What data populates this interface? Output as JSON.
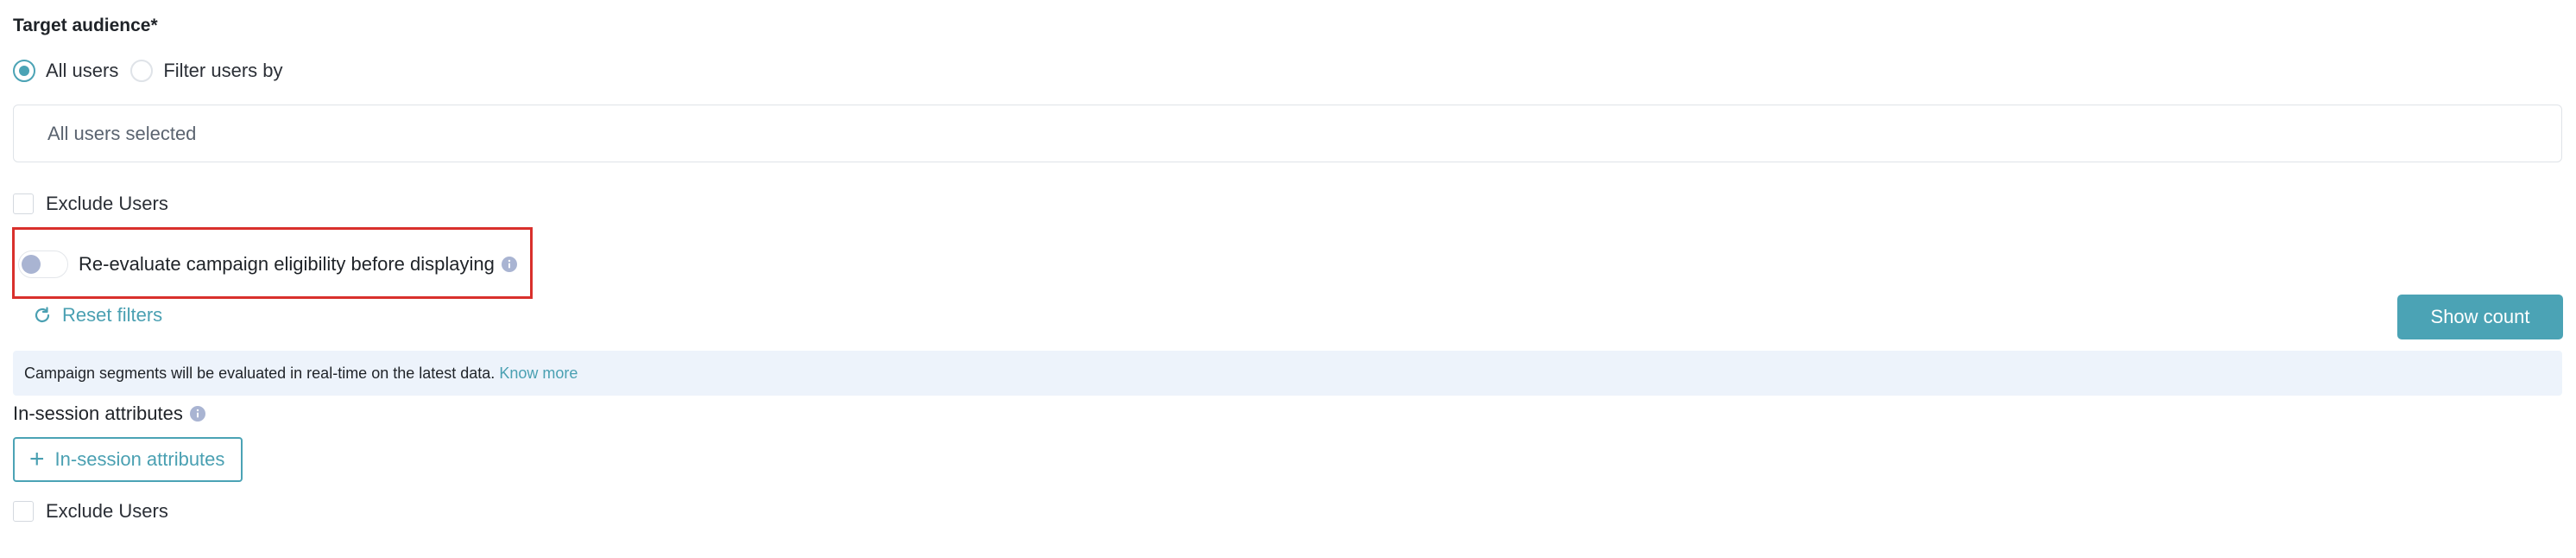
{
  "target_audience": {
    "title": "Target audience*",
    "options": [
      {
        "label": "All users",
        "selected": true
      },
      {
        "label": "Filter users by",
        "selected": false
      }
    ],
    "selection_summary": "All users selected",
    "exclude_users_label": "Exclude Users"
  },
  "reevaluate": {
    "label": "Re-evaluate campaign eligibility before displaying",
    "enabled": false,
    "info_icon": "info-icon"
  },
  "actions": {
    "reset_filters_label": "Reset filters",
    "reset_icon": "refresh-icon",
    "show_count_label": "Show count"
  },
  "banner": {
    "text": "Campaign segments will be evaluated in real-time on the latest data.",
    "link_label": "Know more"
  },
  "in_session": {
    "label": "In-session attributes",
    "button_label": "In-session attributes",
    "button_icon": "plus-icon",
    "exclude_users_label": "Exclude Users"
  },
  "colors": {
    "accent": "#4ba3b5",
    "highlight": "#d9302c",
    "banner_bg": "#edf3fb",
    "toggle_knob": "#a9b4d2"
  }
}
